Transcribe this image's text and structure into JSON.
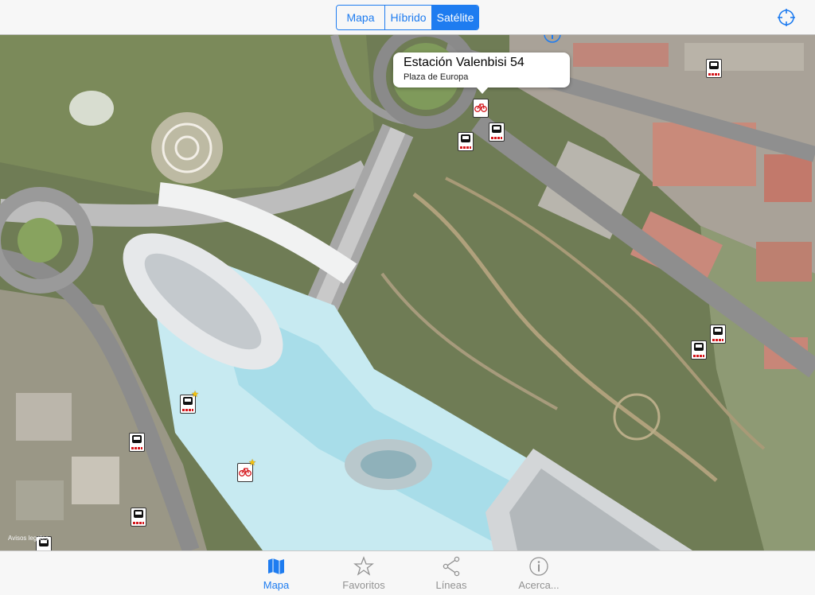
{
  "map_types": {
    "options": [
      "Mapa",
      "Híbrido",
      "Satélite"
    ],
    "selected": "Satélite"
  },
  "icons": {
    "locate": "crosshair-locate-icon",
    "info": "info-circle-icon",
    "bus": "bus-stop-icon",
    "bike": "valenbisi-bike-icon",
    "favorite": "star-icon"
  },
  "callout": {
    "title": "Estación Valenbisi 54",
    "subtitle": "Plaza de Europa"
  },
  "map_legal": "Avisos legales",
  "tabs": [
    {
      "label": "Mapa",
      "icon": "map-icon",
      "active": true
    },
    {
      "label": "Favoritos",
      "icon": "star-outline-icon",
      "active": false
    },
    {
      "label": "Líneas",
      "icon": "share-nodes-icon",
      "active": false
    },
    {
      "label": "Acerca...",
      "icon": "info-circle-icon",
      "active": false
    }
  ],
  "colors": {
    "accent": "#1e7cf0",
    "inactive_tab": "#929292",
    "bus_stripe": "#d4161b"
  }
}
